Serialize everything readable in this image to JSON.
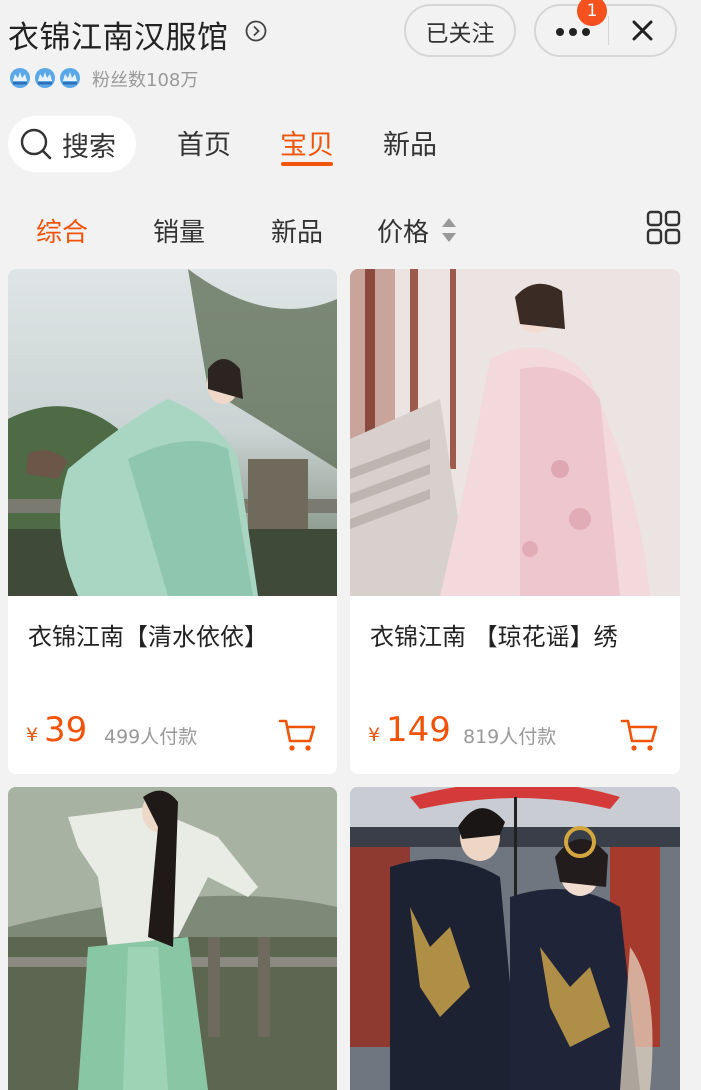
{
  "header": {
    "shop_name": "衣锦江南汉服馆",
    "fans": "粉丝数108万",
    "follow_label": "已关注",
    "notification_count": "1",
    "badge_count": 3
  },
  "nav": {
    "search_label": "搜索",
    "tabs": [
      {
        "label": "首页",
        "active": false
      },
      {
        "label": "宝贝",
        "active": true
      },
      {
        "label": "新品",
        "active": false
      }
    ]
  },
  "sort": {
    "options": [
      {
        "label": "综合",
        "active": true
      },
      {
        "label": "销量",
        "active": false
      },
      {
        "label": "新品",
        "active": false
      },
      {
        "label": "价格",
        "active": false
      }
    ]
  },
  "products": [
    {
      "title": "衣锦江南【清水依依】",
      "currency": "¥",
      "price": "39",
      "sales": "499人付款"
    },
    {
      "title": "衣锦江南 【琼花谣】绣",
      "currency": "¥",
      "price": "149",
      "sales": "819人付款"
    },
    {
      "title": "",
      "currency": "",
      "price": "",
      "sales": ""
    },
    {
      "title": "",
      "currency": "",
      "price": "",
      "sales": ""
    }
  ],
  "colors": {
    "accent": "#f0540a",
    "background": "#f2f2f2",
    "notification": "#f4511e"
  }
}
